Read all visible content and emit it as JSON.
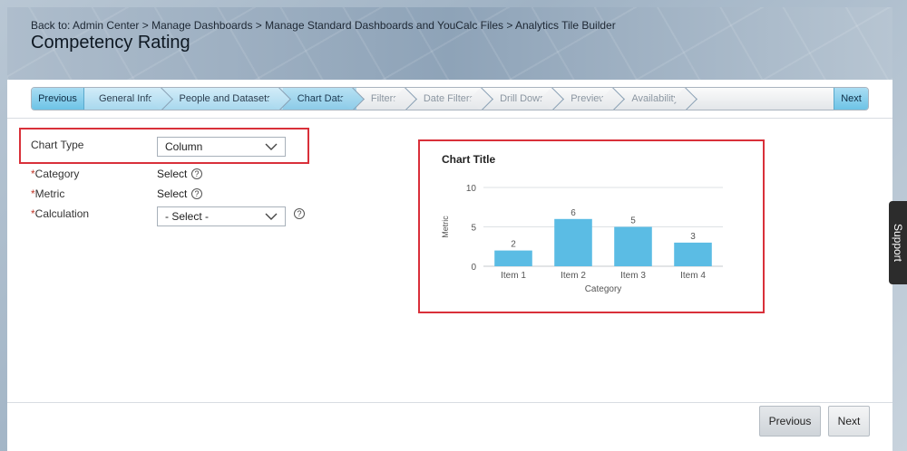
{
  "header": {
    "breadcrumb": "Back to: Admin Center > Manage Dashboards > Manage Standard Dashboards and YouCalc Files > Analytics Tile Builder",
    "title": "Competency Rating"
  },
  "wizard": {
    "previous_label": "Previous",
    "next_label": "Next",
    "steps": [
      {
        "label": "General Info",
        "state": "done"
      },
      {
        "label": "People and Datasets",
        "state": "done"
      },
      {
        "label": "Chart Data",
        "state": "current"
      },
      {
        "label": "Filters",
        "state": "todo"
      },
      {
        "label": "Date Filters",
        "state": "todo"
      },
      {
        "label": "Drill Down",
        "state": "todo"
      },
      {
        "label": "Preview",
        "state": "todo"
      },
      {
        "label": "Availability",
        "state": "todo"
      }
    ]
  },
  "form": {
    "chart_type_label": "Chart Type",
    "chart_type_value": "Column",
    "required_mark": "*",
    "category_label": "Category",
    "category_value": "Select",
    "metric_label": "Metric",
    "metric_value": "Select",
    "calculation_label": "Calculation",
    "calculation_value": "- Select -",
    "help_glyph": "?"
  },
  "chart_data": {
    "type": "bar",
    "title": "Chart Title",
    "categories": [
      "Item 1",
      "Item 2",
      "Item 3",
      "Item 4"
    ],
    "values": [
      2,
      6,
      5,
      3
    ],
    "xlabel": "Category",
    "ylabel": "Metric",
    "ylim": [
      0,
      10
    ],
    "yticks": [
      0,
      5,
      10
    ],
    "grid": true,
    "bar_color": "#5bbce4"
  },
  "footer": {
    "previous_label": "Previous",
    "next_label": "Next"
  },
  "support_label": "Support"
}
